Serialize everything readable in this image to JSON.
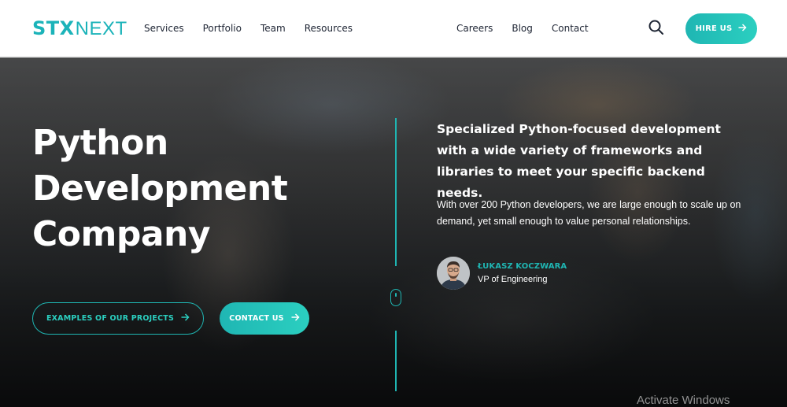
{
  "brand": {
    "logo_bold": "STX",
    "logo_light": "NEXT",
    "accent_color": "#1fb6b3"
  },
  "nav": {
    "left": [
      {
        "label": "Services"
      },
      {
        "label": "Portfolio"
      },
      {
        "label": "Team"
      },
      {
        "label": "Resources"
      }
    ],
    "right": [
      {
        "label": "Careers"
      },
      {
        "label": "Blog"
      },
      {
        "label": "Contact"
      }
    ],
    "search_icon": "search-icon",
    "hire_button": {
      "label": "HIRE US",
      "icon": "arrow-right-icon"
    }
  },
  "hero": {
    "title_lines": [
      "Python",
      "Development",
      "Company"
    ],
    "buttons": {
      "projects": {
        "label": "EXAMPLES OF OUR PROJECTS",
        "icon": "arrow-right-icon"
      },
      "contact": {
        "label": "CONTACT US",
        "icon": "arrow-right-icon"
      }
    },
    "scroll_icon": "mouse-scroll-icon",
    "lead": "Specialized Python-focused development with a wide variety of frameworks and libraries to meet your specific backend needs.",
    "sub": "With over 200 Python developers, we are large enough to scale up on demand, yet small enough to value personal relationships.",
    "person": {
      "name": "ŁUKASZ KOCZWARA",
      "role": "VP of Engineering"
    }
  },
  "overlay": {
    "activate_windows": "Activate Windows"
  }
}
